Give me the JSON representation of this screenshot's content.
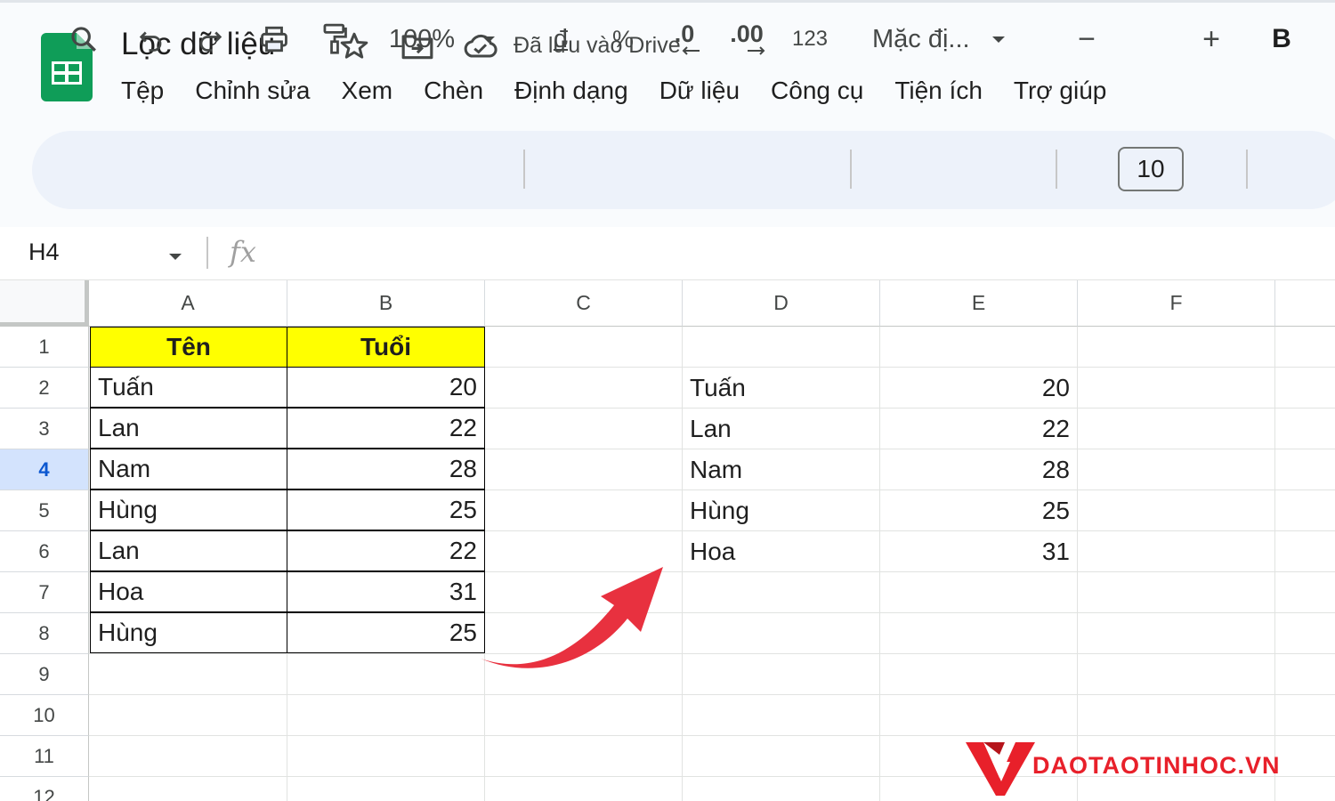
{
  "document": {
    "title": "Lọc dữ liệu",
    "save_status": "Đã lưu vào Drive"
  },
  "menu": [
    "Tệp",
    "Chỉnh sửa",
    "Xem",
    "Chèn",
    "Định dạng",
    "Dữ liệu",
    "Công cụ",
    "Tiện ích",
    "Trợ giúp"
  ],
  "toolbar": {
    "zoom": "100%",
    "currency": "đ",
    "percent": "%",
    "decrease_decimal": ".0",
    "increase_decimal": ".00",
    "number_format": "123",
    "font": "Mặc đị...",
    "font_size": "10",
    "bold": "B",
    "minus": "−",
    "plus": "+"
  },
  "formula_bar": {
    "cell_ref": "H4",
    "fx_label": "fx"
  },
  "grid": {
    "columns": [
      "A",
      "B",
      "C",
      "D",
      "E",
      "F"
    ],
    "rows": [
      "1",
      "2",
      "3",
      "4",
      "5",
      "6",
      "7",
      "8",
      "9",
      "10",
      "11",
      "12"
    ],
    "selected_row": "4",
    "source_header": {
      "name": "Tên",
      "age": "Tuổi"
    },
    "source_data": [
      {
        "name": "Tuấn",
        "age": "20"
      },
      {
        "name": "Lan",
        "age": "22"
      },
      {
        "name": "Nam",
        "age": "28"
      },
      {
        "name": "Hùng",
        "age": "25"
      },
      {
        "name": "Lan",
        "age": "22"
      },
      {
        "name": "Hoa",
        "age": "31"
      },
      {
        "name": "Hùng",
        "age": "25"
      }
    ],
    "result_data": [
      {
        "name": "Tuấn",
        "age": "20"
      },
      {
        "name": "Lan",
        "age": "22"
      },
      {
        "name": "Nam",
        "age": "28"
      },
      {
        "name": "Hùng",
        "age": "25"
      },
      {
        "name": "Hoa",
        "age": "31"
      }
    ]
  },
  "watermark": {
    "text": "DAOTAOTINHOC.VN"
  },
  "colors": {
    "header_fill": "#ffff00",
    "arrow": "#e8313f",
    "selected_row": "#d3e3fd",
    "sheets_green": "#0f9d58"
  }
}
